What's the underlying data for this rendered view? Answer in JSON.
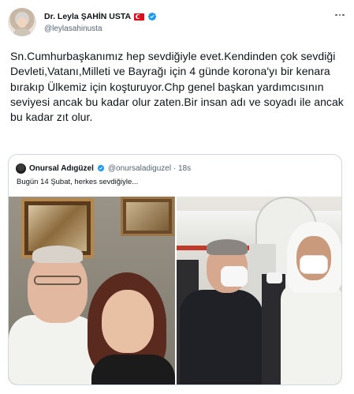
{
  "tweet": {
    "author": {
      "display_name": "Dr. Leyla ŞAHİN USTA",
      "handle": "@leylasahinusta",
      "flag_icon": "turkey-flag-icon",
      "verified_icon": "verified-badge-icon"
    },
    "more_icon": "more-options-icon",
    "text": "Sn.Cumhurbaşkanımız hep sevdiğiyle evet.Kendinden çok sevdiği Devleti,Vatanı,Milleti ve Bayrağı için 4 günde korona'yı bir kenara bırakıp Ülkemiz için koşturuyor.Chp genel başkan yardımcısının seviyesi ancak bu kadar olur zaten.Bir insan adı ve soyadı ile ancak bu kadar zıt olur."
  },
  "quoted_tweet": {
    "author": {
      "display_name": "Onursal Adıgüzel",
      "handle": "@onursaladiguzel · 18s",
      "verified_icon": "verified-badge-icon"
    },
    "text": "Bugün 14 Şubat, herkes sevdiğiyle...",
    "media": [
      "selfie-photo",
      "airport-greeting-photo"
    ]
  },
  "colors": {
    "text_primary": "#0f1419",
    "text_secondary": "#536471",
    "verified_blue": "#1d9bf0",
    "border": "#cfd9de"
  }
}
